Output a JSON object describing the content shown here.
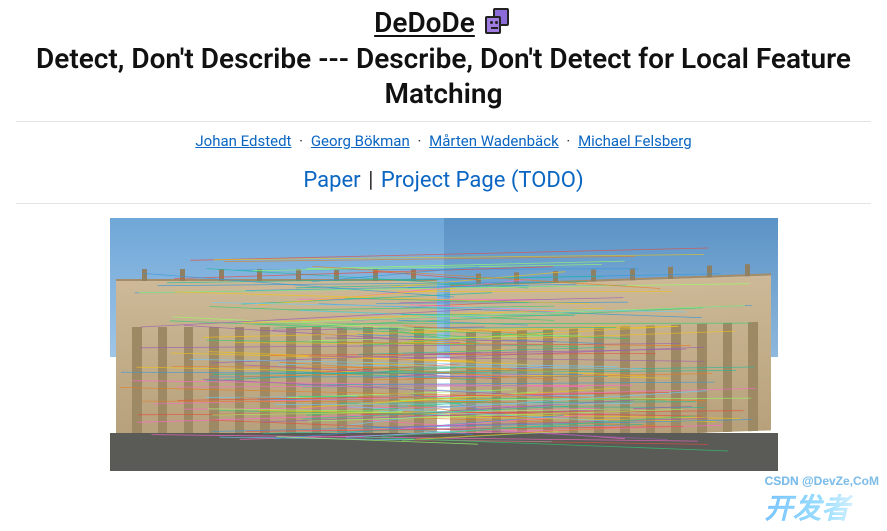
{
  "header": {
    "title": "DeDoDe",
    "icon": "music-notes-icon",
    "subtitle": "Detect, Don't Describe --- Describe, Don't Detect for Local Feature Matching"
  },
  "authors": [
    {
      "name": "Johan Edstedt"
    },
    {
      "name": "Georg Bökman"
    },
    {
      "name": "Mårten Wadenbäck"
    },
    {
      "name": "Michael Felsberg"
    }
  ],
  "author_separator": "·",
  "links": {
    "paper": "Paper",
    "separator": "|",
    "project": "Project Page (TODO)"
  },
  "figure": {
    "description": "Feature matching visualization between two photographs of a classical baroque building facade (St. Peter's Basilica style), showing dense colored correspondence lines connecting matched keypoints across the image pair.",
    "left_scene": "building-facade-view-1",
    "right_scene": "building-facade-view-2"
  },
  "watermark": {
    "small": "CSDN @DevZe,CoM",
    "large": "开发者"
  }
}
